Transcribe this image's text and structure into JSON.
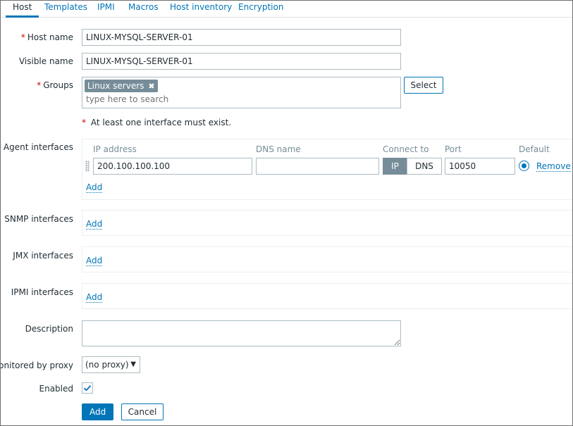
{
  "tabs": [
    {
      "label": "Host",
      "active": true
    },
    {
      "label": "Templates"
    },
    {
      "label": "IPMI"
    },
    {
      "label": "Macros"
    },
    {
      "label": "Host inventory"
    },
    {
      "label": "Encryption"
    }
  ],
  "form": {
    "host_name": {
      "label": "Host name",
      "required": true,
      "value": "LINUX-MYSQL-SERVER-01"
    },
    "visible_name": {
      "label": "Visible name",
      "value": "LINUX-MYSQL-SERVER-01"
    },
    "groups": {
      "label": "Groups",
      "required": true,
      "chips": [
        "Linux servers"
      ],
      "chip_remove": "✖",
      "placeholder": "type here to search",
      "select_label": "Select"
    },
    "interface_hint": {
      "marker": "*",
      "text": "At least one interface must exist."
    },
    "agent_interfaces": {
      "label": "Agent interfaces",
      "columns": {
        "ip": "IP address",
        "dns": "DNS name",
        "connect_to": "Connect to",
        "port": "Port",
        "default": "Default"
      },
      "row": {
        "ip": "200.100.100.100",
        "dns": "",
        "connect_ip": "IP",
        "connect_dns": "DNS",
        "port": "10050",
        "default_selected": true,
        "remove": "Remove"
      },
      "add": "Add"
    },
    "snmp_interfaces": {
      "label": "SNMP interfaces",
      "add": "Add"
    },
    "jmx_interfaces": {
      "label": "JMX interfaces",
      "add": "Add"
    },
    "ipmi_interfaces": {
      "label": "IPMI interfaces",
      "add": "Add"
    },
    "description": {
      "label": "Description",
      "value": ""
    },
    "proxy": {
      "label": "Monitored by proxy",
      "selected": "(no proxy)"
    },
    "enabled": {
      "label": "Enabled",
      "checked": true
    }
  },
  "actions": {
    "add": "Add",
    "cancel": "Cancel"
  },
  "colors": {
    "accent": "#0275b8",
    "required": "#d40000",
    "chip": "#768d99"
  }
}
